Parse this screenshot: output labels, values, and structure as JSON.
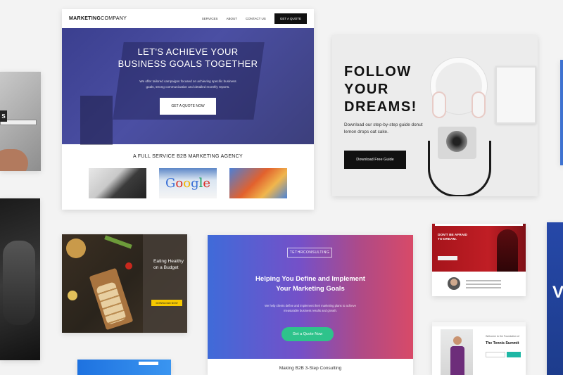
{
  "marketing_card": {
    "logo_bold": "MARKETING",
    "logo_light": "COMPANY",
    "nav_links": [
      "SERVICES",
      "ABOUT",
      "CONTACT US"
    ],
    "nav_button": "GET A QUOTE",
    "hero_title_line1": "LET'S ACHIEVE YOUR",
    "hero_title_line2": "BUSINESS GOALS TOGETHER",
    "hero_text": "We offer tailored campaigns focused on achieving specific business goals, strong communication and detailed monthly reports.",
    "hero_button": "GET A QUOTE NOW",
    "tagline": "A FULL SERVICE B2B MARKETING AGENCY",
    "google_text": "Google"
  },
  "dreams_card": {
    "title_line1": "FOLLOW",
    "title_line2": "YOUR",
    "title_line3": "DREAMS!",
    "text": "Download our step-by-step guide donut lemon drops oat cake.",
    "button": "Download Free Guide"
  },
  "healthy_card": {
    "title_line1": "Eating Healthy",
    "title_line2": "on a Budget",
    "button": "DOWNLOAD NOW"
  },
  "consulting_card": {
    "brand": "TETHRCONSULTING",
    "title_line1": "Helping You Define and Implement",
    "title_line2": "Your Marketing Goals",
    "text": "We help clients define and implement their marketing plans to achieve measurable business results and growth.",
    "button": "Get a Quote Now",
    "subtitle": "Making B2B 3-Step Consulting"
  },
  "afraid_card": {
    "title_line1": "DON'T BE AFRAID",
    "title_line2": "TO DREAM."
  },
  "tennis_card": {
    "small_text": "Welcome to the Foundation of",
    "title": "The Tennis Summit"
  },
  "side_card": {
    "tag": "S"
  }
}
